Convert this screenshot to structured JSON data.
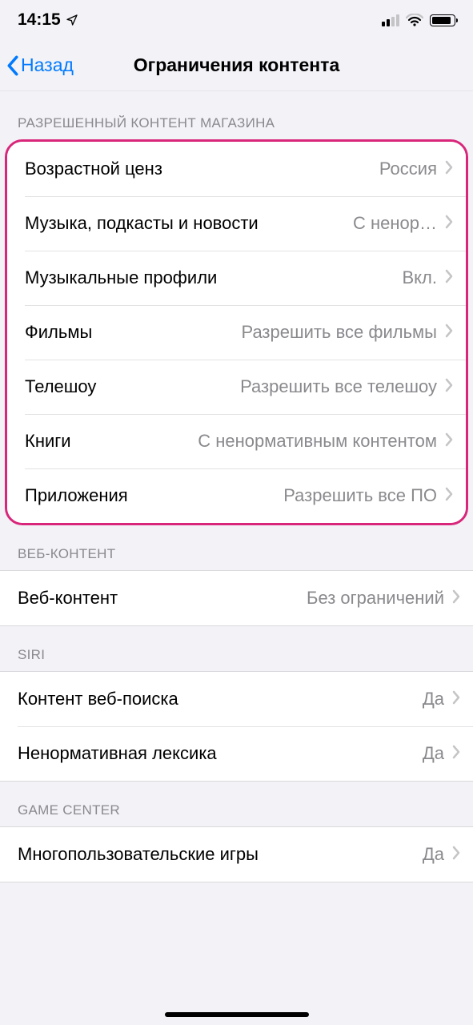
{
  "status": {
    "time": "14:15"
  },
  "nav": {
    "back": "Назад",
    "title": "Ограничения контента"
  },
  "sections": {
    "store": {
      "header": "РАЗРЕШЕННЫЙ КОНТЕНТ МАГАЗИНА",
      "rows": [
        {
          "label": "Возрастной ценз",
          "value": "Россия"
        },
        {
          "label": "Музыка, подкасты и новости",
          "value": "С ненор…"
        },
        {
          "label": "Музыкальные профили",
          "value": "Вкл."
        },
        {
          "label": "Фильмы",
          "value": "Разрешить все фильмы"
        },
        {
          "label": "Телешоу",
          "value": "Разрешить все телешоу"
        },
        {
          "label": "Книги",
          "value": "С ненормативным контентом"
        },
        {
          "label": "Приложения",
          "value": "Разрешить все ПО"
        }
      ]
    },
    "web": {
      "header": "ВЕБ-КОНТЕНТ",
      "rows": [
        {
          "label": "Веб-контент",
          "value": "Без ограничений"
        }
      ]
    },
    "siri": {
      "header": "SIRI",
      "rows": [
        {
          "label": "Контент веб-поиска",
          "value": "Да"
        },
        {
          "label": "Ненормативная лексика",
          "value": "Да"
        }
      ]
    },
    "gamecenter": {
      "header": "GAME CENTER",
      "rows": [
        {
          "label": "Многопользовательские игры",
          "value": "Да"
        }
      ]
    }
  }
}
